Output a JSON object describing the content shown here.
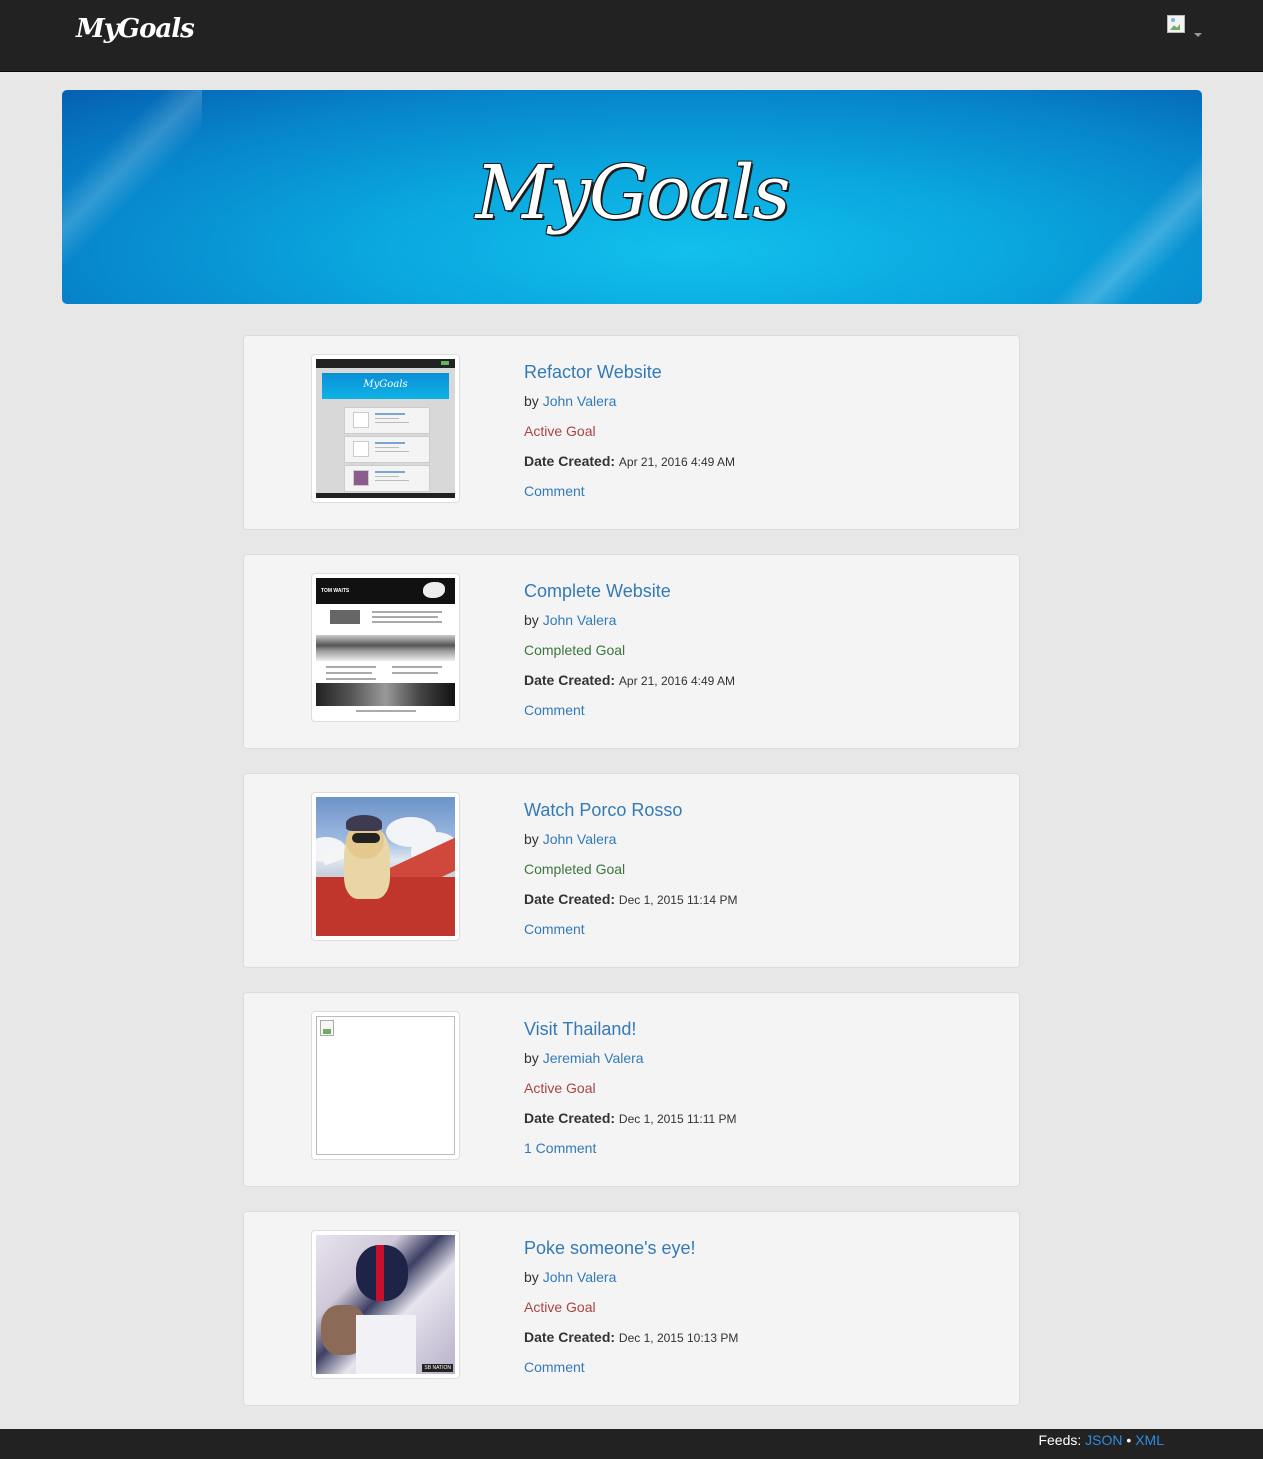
{
  "navbar": {
    "brand": "MyGoals",
    "user_menu_icon": "avatar-broken-image-icon",
    "caret_icon": "caret-down-icon"
  },
  "hero": {
    "title": "MyGoals"
  },
  "goals": [
    {
      "title": "Refactor Website",
      "by_label": "by",
      "author": "John Valera",
      "status": "Active Goal",
      "status_type": "active",
      "date_label": "Date Created:",
      "date": "Apr 21, 2016 4:49 AM",
      "comment": "Comment",
      "thumbnail": "website-screenshot-thumbnail"
    },
    {
      "title": "Complete Website",
      "by_label": "by",
      "author": "John Valera",
      "status": "Completed Goal",
      "status_type": "completed",
      "date_label": "Date Created:",
      "date": "Apr 21, 2016 4:49 AM",
      "comment": "Comment",
      "thumbnail": "tom-waits-website-thumbnail",
      "thumbnail_text": "TOM WAITS"
    },
    {
      "title": "Watch Porco Rosso",
      "by_label": "by",
      "author": "John Valera",
      "status": "Completed Goal",
      "status_type": "completed",
      "date_label": "Date Created:",
      "date": "Dec 1, 2015 11:14 PM",
      "comment": "Comment",
      "thumbnail": "porco-rosso-thumbnail"
    },
    {
      "title": "Visit Thailand!",
      "by_label": "by",
      "author": "Jeremiah Valera",
      "status": "Active Goal",
      "status_type": "active",
      "date_label": "Date Created:",
      "date": "Dec 1, 2015 11:11 PM",
      "comment": "1 Comment",
      "thumbnail": "broken-image-thumbnail"
    },
    {
      "title": "Poke someone's eye!",
      "by_label": "by",
      "author": "John Valera",
      "status": "Active Goal",
      "status_type": "active",
      "date_label": "Date Created:",
      "date": "Dec 1, 2015 10:13 PM",
      "comment": "Comment",
      "thumbnail": "football-players-thumbnail",
      "thumbnail_text": "SB NATION"
    }
  ],
  "footer": {
    "label": "Feeds:",
    "json": "JSON",
    "separator": "•",
    "xml": "XML"
  },
  "colors": {
    "navbar": "#222222",
    "link": "#337ab7",
    "active": "#a94442",
    "completed": "#3c763d",
    "page_bg": "#e8e7e7",
    "card_bg": "#f4f4f4"
  }
}
